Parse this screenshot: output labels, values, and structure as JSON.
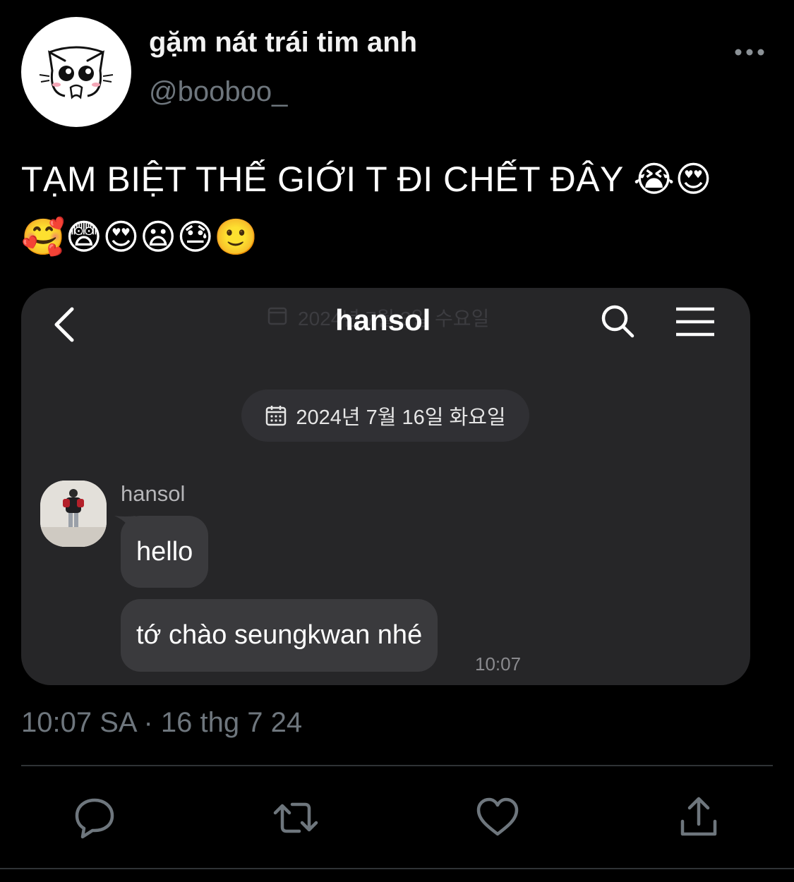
{
  "tweet": {
    "display_name": "gặm nát trái tim anh",
    "handle": "@booboo_",
    "text_line1": "TẠM BIỆT THẾ GIỚI T ĐI CHẾT ĐÂY 😭😍",
    "text_line2": "🥰😨😍😦😓🙂",
    "timestamp": "10:07 SA · 16 thg 7 24"
  },
  "chat": {
    "title": "hansol",
    "ghost_header_date": "2024년 7월 3일 수요일",
    "date_pill": "2024년 7월 16일 화요일",
    "sender": "hansol",
    "messages": [
      {
        "text": "hello"
      },
      {
        "text": "tớ chào seungkwan nhé"
      }
    ],
    "last_time": "10:07"
  },
  "icons": {
    "more": "more-horizontal-icon",
    "back": "chevron-left-icon",
    "search": "search-icon",
    "menu": "hamburger-menu-icon",
    "calendar": "calendar-icon",
    "reply": "reply-icon",
    "retweet": "retweet-icon",
    "like": "heart-icon",
    "share": "share-icon"
  },
  "colors": {
    "background": "#000000",
    "secondary_text": "#6e767d",
    "card_background": "#262628",
    "bubble": "#3a3a3d",
    "icon": "#6e767d"
  }
}
